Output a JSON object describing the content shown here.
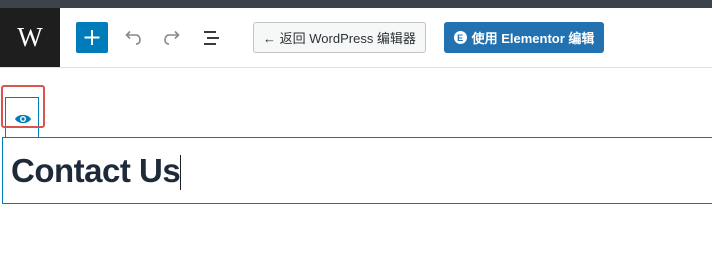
{
  "app": {
    "logo_letter": "W"
  },
  "toolbar": {
    "add_icon": "plus-icon",
    "undo_icon": "undo-icon",
    "redo_icon": "redo-icon",
    "outline_icon": "list-view-icon",
    "back_button_label": "← 返回 WordPress 编辑器",
    "elementor_button_label": "使用 Elementor 编辑",
    "elementor_badge": "E",
    "accent_color": "#007cba",
    "button_color": "#2271b1"
  },
  "block": {
    "preview_icon": "eye-icon",
    "highlight_color": "#d9534f"
  },
  "title": {
    "text": "Contact Us"
  }
}
